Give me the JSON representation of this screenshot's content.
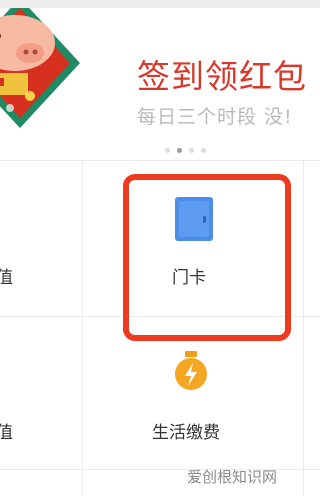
{
  "banner": {
    "title": "签到领红包",
    "subtitle": "每日三个时段 没!",
    "pager": {
      "count": 4,
      "active_index": 1
    }
  },
  "grid": {
    "cells": [
      {
        "label": "值",
        "icon": ""
      },
      {
        "label": "门卡",
        "icon": "door-icon"
      },
      {
        "label": "值",
        "icon": ""
      },
      {
        "label": "生活缴费",
        "icon": "lightbulb-icon"
      }
    ]
  },
  "watermark": {
    "text": "爱创根知识网"
  },
  "colors": {
    "accent_red": "#d8382a",
    "highlight_red": "#ee3a1f",
    "door_blue": "#4a8ee8",
    "bulb_orange": "#f5a623"
  }
}
